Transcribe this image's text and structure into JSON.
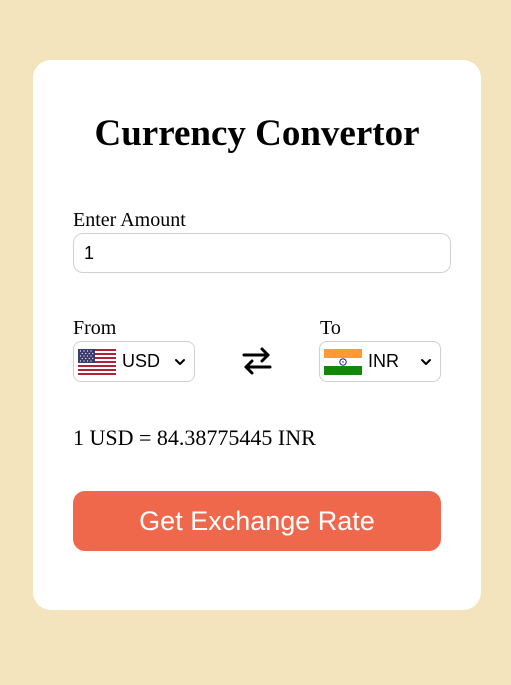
{
  "app": {
    "title": "Currency Convertor"
  },
  "amount": {
    "label": "Enter Amount",
    "value": "1"
  },
  "from": {
    "label": "From",
    "code": "USD",
    "flag_icon": "us-flag-icon"
  },
  "to": {
    "label": "To",
    "code": "INR",
    "flag_icon": "india-flag-icon"
  },
  "swap_icon": "swap-arrows-icon",
  "result": {
    "text": "1 USD = 84.38775445 INR"
  },
  "button": {
    "label": "Get Exchange Rate"
  },
  "colors": {
    "page_background": "#f3e4bd",
    "card_background": "#ffffff",
    "button": "#ef684c",
    "button_text": "#ffffff"
  }
}
